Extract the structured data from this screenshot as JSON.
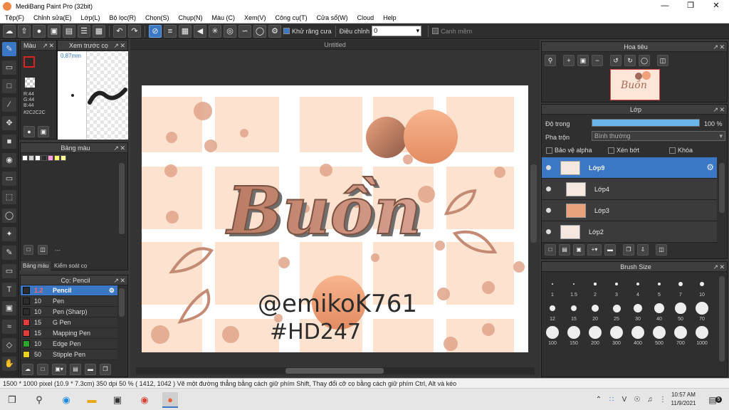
{
  "window": {
    "title": "MediBang Paint Pro (32bit)"
  },
  "menu": [
    "Tệp(F)",
    "Chỉnh sửa(E)",
    "Lớp(L)",
    "Bộ lọc(R)",
    "Chọn(S)",
    "Chụp(N)",
    "Màu (C)",
    "Xem(V)",
    "Công cụ(T)",
    "Cửa sổ(W)",
    "Cloud",
    "Help"
  ],
  "toolbar": {
    "antialias_label": "Khử răng cưa",
    "correction_label": "Điều chỉnh",
    "correction_value": "0",
    "snap_label": "Canh mềm"
  },
  "color_panel": {
    "title": "Màu",
    "preview_title": "Xem trước cọ",
    "brush_size": "0.87mm",
    "r": "R:44",
    "g": "G:44",
    "b": "B:44",
    "hex": "#2C2C2C",
    "main_color": "#2c2c2c"
  },
  "palette_panel": {
    "title": "Bảng màu",
    "tab_palette": "Bảng màu",
    "tab_brush_control": "Kiểm soát cọ",
    "dashes": "---",
    "swatches": [
      "#ffffff",
      "#d0d0d0",
      "#ffffff",
      "#2c2c2c",
      "#ff9ad8",
      "#ffff66",
      "#ffff99"
    ]
  },
  "pen_panel": {
    "title": "Cọ: Pencil",
    "pens": [
      {
        "size": "1.2",
        "name": "Pencil",
        "color": "#2c2c2c",
        "selected": true
      },
      {
        "size": "10",
        "name": "Pen",
        "color": "#2c2c2c",
        "selected": false
      },
      {
        "size": "10",
        "name": "Pen (Sharp)",
        "color": "#2c2c2c",
        "selected": false
      },
      {
        "size": "15",
        "name": "G Pen",
        "color": "#e23b3b",
        "selected": false
      },
      {
        "size": "15",
        "name": "Mapping Pen",
        "color": "#e23b3b",
        "selected": false
      },
      {
        "size": "10",
        "name": "Edge Pen",
        "color": "#2ca52c",
        "selected": false
      },
      {
        "size": "50",
        "name": "Stipple Pen",
        "color": "#e8d21a",
        "selected": false
      }
    ]
  },
  "canvas": {
    "tab_title": "Untitled",
    "main_text": "Buồn",
    "handle": "@emikoK761",
    "hashtag": "#HD247"
  },
  "navigator": {
    "title": "Hoa tiêu"
  },
  "layer_panel": {
    "title": "Lớp",
    "opacity_label": "Độ trong",
    "opacity_value": "100 %",
    "opacity": 1.0,
    "blend_label": "Pha trộn",
    "blend_value": "Bình thường",
    "protect_alpha": "Bảo vệ alpha",
    "clip": "Xén bớt",
    "lock": "Khóa",
    "layers": [
      {
        "name": "Lớp9",
        "selected": true
      },
      {
        "name": "Lớp4",
        "selected": false
      },
      {
        "name": "Lớp3",
        "selected": false
      },
      {
        "name": "Lớp2",
        "selected": false
      }
    ]
  },
  "brush_size_panel": {
    "title": "Brush Size",
    "sizes": [
      "1",
      "1.5",
      "2",
      "3",
      "4",
      "5",
      "7",
      "10",
      "12",
      "15",
      "20",
      "25",
      "30",
      "40",
      "50",
      "70",
      "100",
      "150",
      "200",
      "300",
      "400",
      "500",
      "700",
      "1000"
    ]
  },
  "status": {
    "text": "1500 * 1000 pixel   (10.9 * 7.3cm)   350 dpi   50 %   ( 1412, 1042 )   Vẽ một đường thẳng bằng cách giữ phím Shift, Thay đổi cỡ cọ bằng cách giữ phím Ctrl, Alt và kéo"
  },
  "taskbar": {
    "time": "10:57 AM",
    "date": "11/9/2021",
    "notif_count": "5"
  }
}
